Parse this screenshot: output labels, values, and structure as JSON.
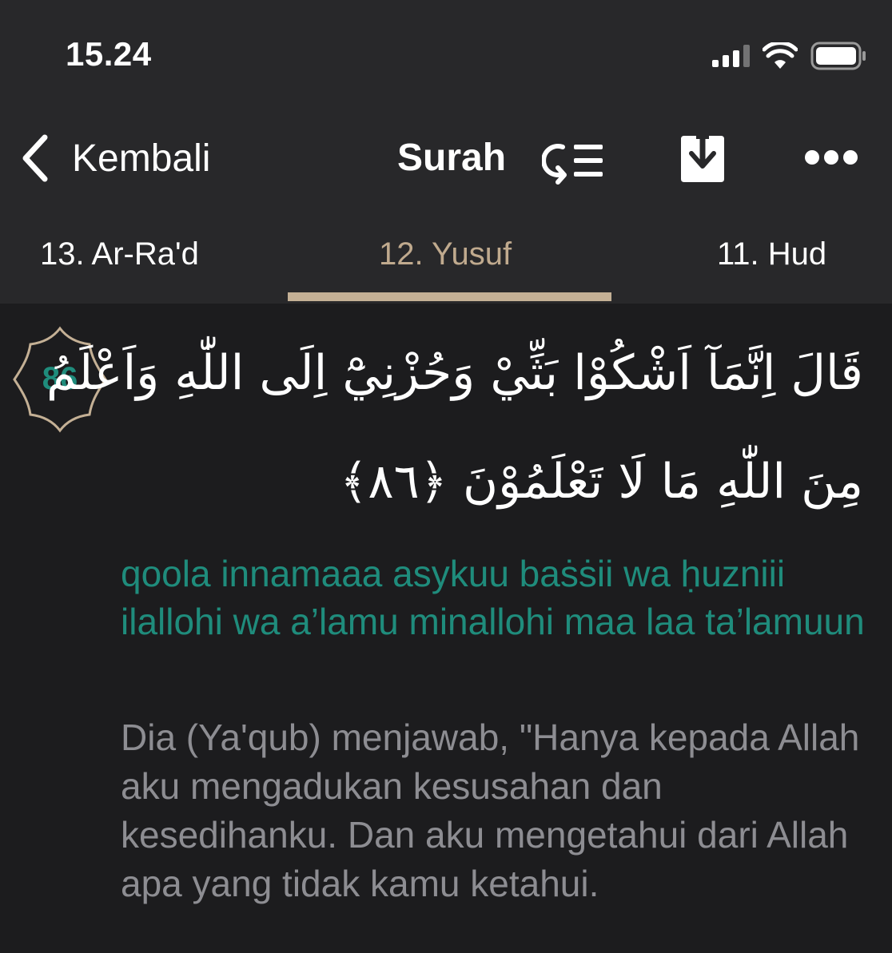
{
  "status_bar": {
    "time": "15.24"
  },
  "nav": {
    "back_label": "Kembali",
    "title": "Surah"
  },
  "tabs": [
    {
      "label": "13. Ar-Ra'd",
      "active": false
    },
    {
      "label": "12. Yusuf",
      "active": true
    },
    {
      "label": "11. Hud",
      "active": false
    }
  ],
  "verse": {
    "number": "86",
    "arabic_line_1": "قَالَ اِنَّمَآ اَشْكُوْا بَثِّيْ وَحُزْنِيْٓ اِلَى اللّٰهِ وَاَعْلَمُ",
    "arabic_line_2": "مِنَ اللّٰهِ مَا لَا تَعْلَمُوْنَ ﴿٨٦﴾",
    "transliteration": "qoola innamaaa asykuu baṡṡii wa ḥuzniii ilallohi wa a’lamu minallohi maa laa ta’lamuun",
    "translation": "Dia (Ya'qub) menjawab, \"Hanya kepada Allah aku mengadukan kesusahan dan kesedihanku. Dan aku mengetahui dari Allah apa yang tidak kamu ketahui."
  },
  "colors": {
    "header_background": "#28282a",
    "content_background": "#1c1c1e",
    "accent_gold": "#c4b095",
    "transliteration_teal": "#1f8c7c",
    "translation_gray": "#8d8d92"
  },
  "icons": {
    "back": "chevron-left-icon",
    "jump_to_verse": "verse-list-icon",
    "download": "download-icon",
    "more": "more-horizontal-icon",
    "ayah_marker": "ornamental-ayah-badge-icon"
  }
}
